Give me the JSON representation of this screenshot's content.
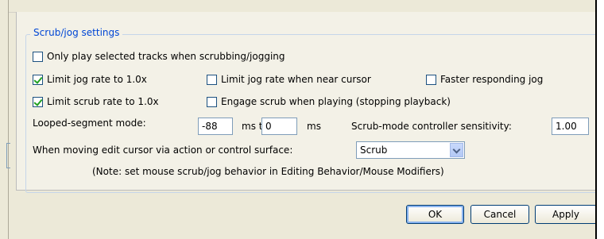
{
  "group": {
    "title": "Scrub/jog settings"
  },
  "options": {
    "only_selected": {
      "label": "Only play selected tracks when scrubbing/jogging",
      "checked": false
    },
    "limit_jog": {
      "label": "Limit jog rate to 1.0x",
      "checked": true
    },
    "limit_jog_near_cursor": {
      "label": "Limit jog rate when near cursor",
      "checked": false
    },
    "faster_jog": {
      "label": "Faster responding jog",
      "checked": false
    },
    "limit_scrub": {
      "label": "Limit scrub rate to 1.0x",
      "checked": true
    },
    "engage_scrub": {
      "label": "Engage scrub when playing (stopping playback)",
      "checked": false
    }
  },
  "looped": {
    "label": "Looped-segment mode:",
    "from_value": "-88",
    "ms_to": "ms to",
    "to_value": "0",
    "ms": "ms"
  },
  "sensitivity": {
    "label": "Scrub-mode controller sensitivity:",
    "value": "1.00"
  },
  "edit_cursor": {
    "label": "When moving edit cursor via action or control surface:",
    "selected": "Scrub"
  },
  "note": "(Note: set mouse scrub/jog behavior in Editing Behavior/Mouse Modifiers)",
  "buttons": {
    "ok": "OK",
    "cancel": "Cancel",
    "apply": "Apply"
  },
  "colors": {
    "legend": "#0046d5",
    "check": "#21a121",
    "border": "#7f9db9"
  }
}
